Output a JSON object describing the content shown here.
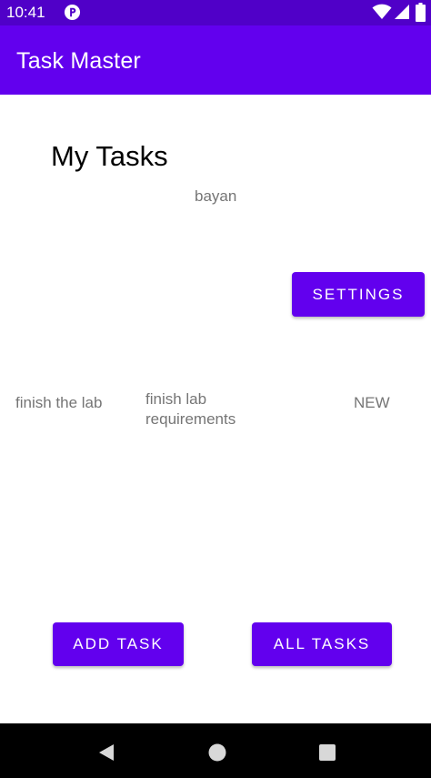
{
  "status_bar": {
    "time": "10:41",
    "color": "#5000c8",
    "icons": [
      "app-notification-icon",
      "wifi-icon",
      "cell-signal-icon",
      "battery-icon"
    ]
  },
  "app_bar": {
    "title": "Task Master",
    "color": "#6200ee"
  },
  "main": {
    "page_title": "My Tasks",
    "username": "bayan",
    "settings_label": "SETTINGS",
    "tasks": [
      {
        "title": "finish the lab"
      },
      {
        "title": "finish lab requirements"
      },
      {
        "title": "NEW"
      }
    ],
    "add_task_label": "ADD TASK",
    "all_tasks_label": "ALL TASKS",
    "accent_color": "#6200ee"
  },
  "nav_bar": {
    "icons": [
      "back-icon",
      "home-icon",
      "recents-icon"
    ]
  }
}
